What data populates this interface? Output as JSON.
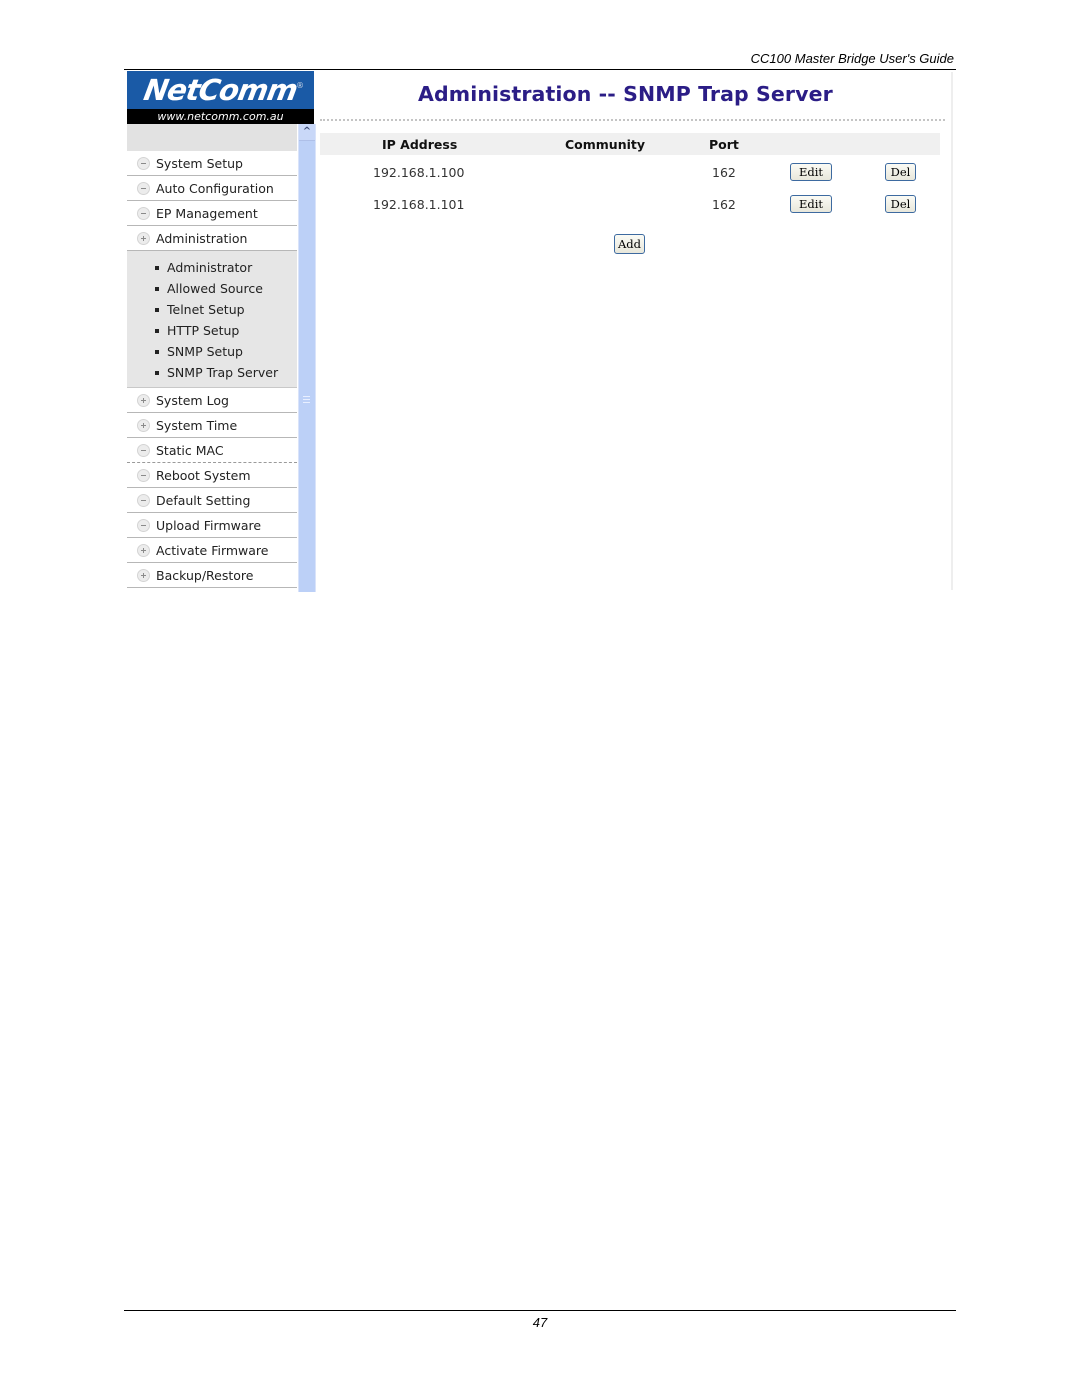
{
  "document": {
    "header_text": "CC100 Master Bridge User's Guide",
    "page_number": "47"
  },
  "logo": {
    "brand": "NetComm",
    "registered": "®",
    "url": "www.netcomm.com.au"
  },
  "sidebar": {
    "items_before": [
      {
        "label": "System Setup",
        "icon": "minus"
      },
      {
        "label": "Auto Configuration",
        "icon": "minus"
      },
      {
        "label": "EP Management",
        "icon": "minus"
      },
      {
        "label": "Administration",
        "icon": "plus"
      }
    ],
    "submenu": [
      {
        "label": "Administrator"
      },
      {
        "label": "Allowed Source"
      },
      {
        "label": "Telnet Setup"
      },
      {
        "label": "HTTP Setup"
      },
      {
        "label": "SNMP Setup"
      },
      {
        "label": "SNMP Trap Server"
      }
    ],
    "items_after": [
      {
        "label": "System Log",
        "icon": "plus"
      },
      {
        "label": "System Time",
        "icon": "plus"
      },
      {
        "label": "Static MAC",
        "icon": "minus"
      },
      {
        "label": "Reboot System",
        "icon": "minus"
      },
      {
        "label": "Default Setting",
        "icon": "minus"
      },
      {
        "label": "Upload Firmware",
        "icon": "minus"
      },
      {
        "label": "Activate Firmware",
        "icon": "plus"
      },
      {
        "label": "Backup/Restore",
        "icon": "plus"
      }
    ],
    "scroll_up_glyph": "^"
  },
  "main": {
    "title": "Administration -- SNMP Trap Server",
    "columns": {
      "ip": "IP Address",
      "community": "Community",
      "port": "Port"
    },
    "rows": [
      {
        "ip": "192.168.1.100",
        "community": "",
        "port": "162",
        "edit_label": "Edit",
        "del_label": "Del"
      },
      {
        "ip": "192.168.1.101",
        "community": "",
        "port": "162",
        "edit_label": "Edit",
        "del_label": "Del"
      }
    ],
    "add_label": "Add"
  }
}
